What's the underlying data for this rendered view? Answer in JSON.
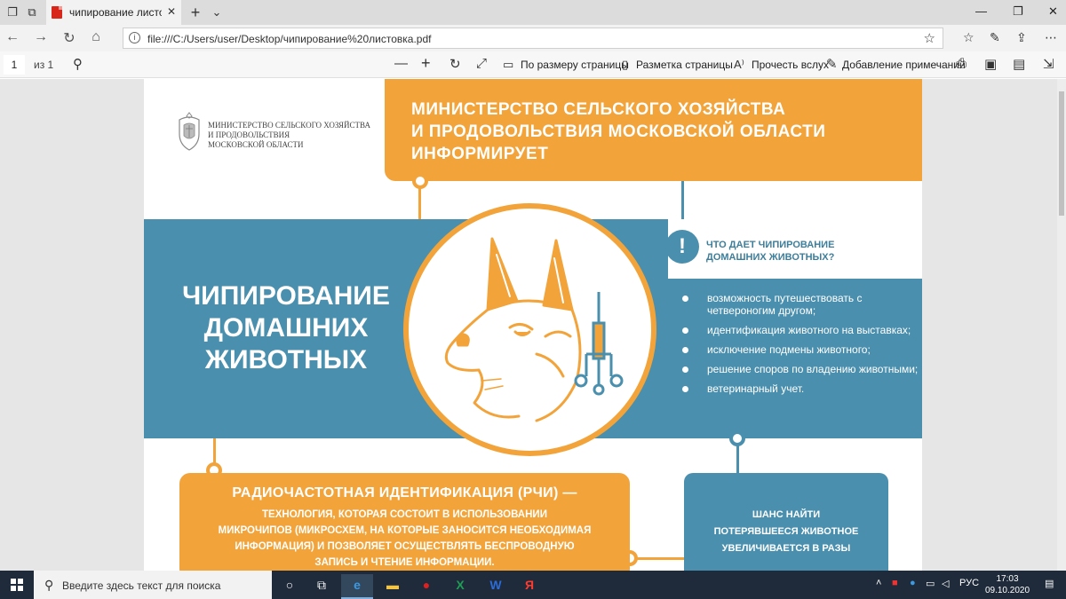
{
  "browser": {
    "tab_title": "чипирование листовка",
    "url": "file:///C:/Users/user/Desktop/чипирование%20листовка.pdf"
  },
  "pdf_toolbar": {
    "page_number": "1",
    "page_count": "из 1",
    "fit_page": "По размеру страницы",
    "page_layout": "Разметка страницы",
    "read_aloud": "Прочесть вслух",
    "add_notes": "Добавление примечаний"
  },
  "document": {
    "ministry_logo_text": [
      "МИНИСТЕРСТВО СЕЛЬСКОГО ХОЗЯЙСТВА",
      "И ПРОДОВОЛЬСТВИЯ",
      "МОСКОВСКОЙ ОБЛАСТИ"
    ],
    "header_lines": [
      "МИНИСТЕРСТВО СЕЛЬСКОГО ХОЗЯЙСТВА",
      "И ПРОДОВОЛЬСТВИЯ МОСКОВСКОЙ ОБЛАСТИ",
      "ИНФОРМИРУЕТ"
    ],
    "main_title_lines": [
      "ЧИПИРОВАНИЕ",
      "ДОМАШНИХ",
      "ЖИВОТНЫХ"
    ],
    "question_mark": "!",
    "question_lines": [
      "ЧТО ДАЕТ ЧИПИРОВАНИЕ",
      "ДОМАШНИХ ЖИВОТНЫХ?"
    ],
    "benefits": [
      "возможность путешествовать с четвероногим другом;",
      "идентификация животного на выставках;",
      "исключение подмены животного;",
      "решение споров по владению животными;",
      "ветеринарный учет."
    ],
    "rfid_title": "РАДИОЧАСТОТНАЯ ИДЕНТИФИКАЦИЯ (РЧИ) —",
    "rfid_lines": [
      "ТЕХНОЛОГИЯ, КОТОРАЯ СОСТОИТ В ИСПОЛЬЗОВАНИИ",
      "МИКРОЧИПОВ (МИКРОСХЕМ, НА КОТОРЫЕ ЗАНОСИТСЯ НЕОБХОДИМАЯ",
      "ИНФОРМАЦИЯ) И ПОЗВОЛЯЕТ ОСУЩЕСТВЛЯТЬ БЕСПРОВОДНУЮ",
      "ЗАПИСЬ И ЧТЕНИЕ ИНФОРМАЦИИ."
    ],
    "chance_lines": [
      "ШАНС НАЙТИ",
      "ПОТЕРЯВШЕЕСЯ ЖИВОТНОЕ",
      "УВЕЛИЧИВАЕТСЯ В РАЗЫ"
    ]
  },
  "taskbar": {
    "search_placeholder": "Введите здесь текст для поиска",
    "language": "РУС",
    "time": "17:03",
    "date": "09.10.2020"
  },
  "colors": {
    "orange": "#f2a33a",
    "blue": "#4a8fad",
    "pdf_red": "#d8261b"
  }
}
